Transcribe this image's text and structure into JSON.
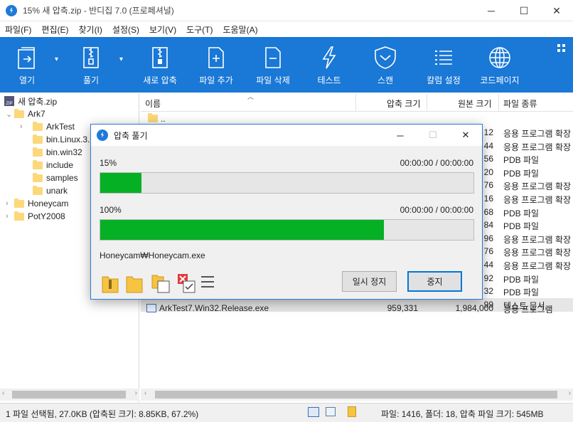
{
  "window": {
    "title": "15% 새 압축.zip - 반디집 7.0 (프로페셔널)",
    "minimize": "─",
    "maximize": "☐",
    "close": "✕"
  },
  "menu": [
    "파일(F)",
    "편집(E)",
    "찾기(I)",
    "설정(S)",
    "보기(V)",
    "도구(T)",
    "도움말(A)"
  ],
  "toolbar": {
    "open": "열기",
    "extract": "풀기",
    "new_archive": "새로 압축",
    "add_file": "파일 추가",
    "delete_file": "파일 삭제",
    "test": "테스트",
    "scan": "스캔",
    "column_settings": "칼럼 설정",
    "codepage": "코드페이지",
    "accent_color": "#1a78d6"
  },
  "tree": {
    "root": "새 압축.zip",
    "items": [
      {
        "label": "Ark7"
      },
      {
        "label": "ArkTest"
      },
      {
        "label": "bin.Linux.3."
      },
      {
        "label": "bin.win32"
      },
      {
        "label": "include"
      },
      {
        "label": "samples"
      },
      {
        "label": "unark"
      },
      {
        "label": "Honeycam"
      },
      {
        "label": "PotY2008"
      }
    ]
  },
  "list": {
    "columns": {
      "name": "이름",
      "packed": "압축 크기",
      "original": "원본 크기",
      "type": "파일 종류"
    },
    "parent": "..",
    "rows": [
      {
        "original": "12",
        "type": "응용 프로그램 확장"
      },
      {
        "original": "44",
        "type": "응용 프로그램 확장"
      },
      {
        "original": "56",
        "type": "PDB 파일"
      },
      {
        "original": "20",
        "type": "PDB 파일"
      },
      {
        "original": "76",
        "type": "응용 프로그램 확장"
      },
      {
        "original": "16",
        "type": "응용 프로그램 확장"
      },
      {
        "original": "68",
        "type": "PDB 파일"
      },
      {
        "original": "84",
        "type": "PDB 파일"
      },
      {
        "original": "96",
        "type": "응용 프로그램 확장"
      },
      {
        "original": "76",
        "type": "응용 프로그램 확장"
      },
      {
        "original": "44",
        "type": "응용 프로그램 확장"
      },
      {
        "original": "92",
        "type": "PDB 파일"
      },
      {
        "original": "32",
        "type": "PDB 파일"
      },
      {
        "original": "99",
        "type": "텍스트 문서"
      }
    ],
    "last_row": {
      "name": "ArkTest7.Win32.Release.exe",
      "packed": "959,331",
      "original": "1,984,000",
      "type": "응용 프로그램"
    }
  },
  "status": {
    "left": "1 파일 선택됨, 27.0KB (압축된 크기: 8.85KB, 67.2%)",
    "right": "파일: 1416, 폴더: 18, 압축 파일 크기: 545MB"
  },
  "dialog": {
    "title": "압축 풀기",
    "file_percent": "15%",
    "file_time": "00:00:00 / 00:00:00",
    "file_progress": 0.11,
    "total_percent": "100%",
    "total_time": "00:00:00 / 00:00:00",
    "total_progress": 0.76,
    "current_file": "Honeycam₩Honeycam.exe",
    "pause": "일시 정지",
    "stop": "중지",
    "progress_color": "#06b025"
  }
}
